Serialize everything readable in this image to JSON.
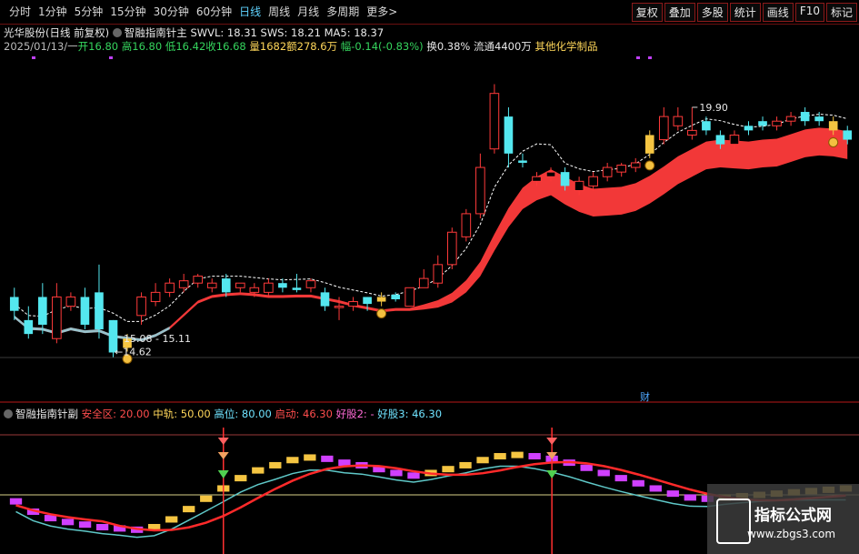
{
  "toolbar": {
    "periods": [
      "分时",
      "1分钟",
      "5分钟",
      "15分钟",
      "30分钟",
      "60分钟",
      "日线",
      "周线",
      "月线",
      "多周期",
      "更多>"
    ],
    "active_period": "日线",
    "right_buttons": [
      "复权",
      "叠加",
      "多股",
      "统计",
      "画线",
      "F10",
      "标记"
    ]
  },
  "header": {
    "stock": "光华股份(日线 前复权)",
    "indicator": "智融指南针主",
    "swvl": "SWVL: 18.31",
    "sws": "SWS: 18.21",
    "ma5": "MA5: 18.37",
    "date": "2025/01/13/一",
    "open": "开16.80",
    "high": "高16.80",
    "low": "低16.42",
    "close": "收16.68",
    "vol": "量1682",
    "amount": "额278.6万",
    "change": "幅-0.14(-0.83%)",
    "turnover": "换0.38%",
    "float": "流通4400万",
    "sector": "其他化学制品"
  },
  "annotations": {
    "high_label": "19.90",
    "low_label": "14.62",
    "range_label": "15.08 - 15.11",
    "cai_label": "财"
  },
  "lower_panel": {
    "title": "智融指南针副",
    "safe": "安全区: 20.00",
    "mid": "中轨: 50.00",
    "high": "高位: 80.00",
    "start": "启动: 46.30",
    "good2": "好股2: -",
    "good3": "好股3: 46.30"
  },
  "watermark": {
    "name": "指标公式网",
    "url": "www.zbgs3.com"
  },
  "colors": {
    "up": "#ff3a3a",
    "down": "#54e7ef",
    "band": "#ff3b3b",
    "gold": "#f5c542"
  },
  "chart_data": {
    "type": "candlestick",
    "note": "daily candles, price axis approx 14 - 21",
    "candles": [
      {
        "o": 15.8,
        "c": 15.5,
        "h": 16.0,
        "l": 15.3
      },
      {
        "o": 15.3,
        "c": 15.0,
        "h": 15.6,
        "l": 14.9
      },
      {
        "o": 15.8,
        "c": 15.2,
        "h": 16.1,
        "l": 15.0
      },
      {
        "o": 14.9,
        "c": 15.8,
        "h": 16.1,
        "l": 14.8
      },
      {
        "o": 15.6,
        "c": 15.8,
        "h": 15.9,
        "l": 15.5
      },
      {
        "o": 15.8,
        "c": 15.2,
        "h": 16.0,
        "l": 15.1
      },
      {
        "o": 15.9,
        "c": 15.1,
        "h": 16.5,
        "l": 14.9
      },
      {
        "o": 15.3,
        "c": 14.6,
        "h": 15.3,
        "l": 14.5
      },
      {
        "o": 14.7,
        "c": 14.9,
        "h": 15.0,
        "l": 14.62
      },
      {
        "o": 15.4,
        "c": 15.8,
        "h": 15.9,
        "l": 15.2
      },
      {
        "o": 15.7,
        "c": 15.9,
        "h": 16.1,
        "l": 15.6
      },
      {
        "o": 15.9,
        "c": 16.1,
        "h": 16.2,
        "l": 15.8
      },
      {
        "o": 16.0,
        "c": 16.15,
        "h": 16.3,
        "l": 15.9
      },
      {
        "o": 16.1,
        "c": 16.25,
        "h": 16.3,
        "l": 16.0
      },
      {
        "o": 16.0,
        "c": 16.1,
        "h": 16.2,
        "l": 15.9
      },
      {
        "o": 16.2,
        "c": 15.9,
        "h": 16.3,
        "l": 15.8
      },
      {
        "o": 16.0,
        "c": 16.1,
        "h": 16.1,
        "l": 15.9
      },
      {
        "o": 15.9,
        "c": 16.0,
        "h": 16.1,
        "l": 15.8
      },
      {
        "o": 15.9,
        "c": 16.1,
        "h": 16.2,
        "l": 15.8
      },
      {
        "o": 16.1,
        "c": 16.0,
        "h": 16.2,
        "l": 15.9
      },
      {
        "o": 16.0,
        "c": 15.95,
        "h": 16.3,
        "l": 15.9
      },
      {
        "o": 16.0,
        "c": 16.15,
        "h": 16.2,
        "l": 15.9
      },
      {
        "o": 15.9,
        "c": 15.6,
        "h": 16.0,
        "l": 15.5
      },
      {
        "o": 15.6,
        "c": 15.6,
        "h": 15.8,
        "l": 15.3
      },
      {
        "o": 15.6,
        "c": 15.7,
        "h": 15.8,
        "l": 15.5
      },
      {
        "o": 15.8,
        "c": 15.65,
        "h": 15.8,
        "l": 15.5
      },
      {
        "o": 15.7,
        "c": 15.8,
        "h": 15.9,
        "l": 15.6
      },
      {
        "o": 15.85,
        "c": 15.75,
        "h": 15.9,
        "l": 15.7
      },
      {
        "o": 15.6,
        "c": 16.0,
        "h": 16.0,
        "l": 15.6
      },
      {
        "o": 16.0,
        "c": 16.2,
        "h": 16.4,
        "l": 16.0
      },
      {
        "o": 16.1,
        "c": 16.5,
        "h": 16.7,
        "l": 16.0
      },
      {
        "o": 16.5,
        "c": 17.2,
        "h": 17.3,
        "l": 16.4
      },
      {
        "o": 17.1,
        "c": 17.6,
        "h": 17.7,
        "l": 17.0
      },
      {
        "o": 17.6,
        "c": 18.6,
        "h": 18.9,
        "l": 17.5
      },
      {
        "o": 19.0,
        "c": 20.2,
        "h": 20.4,
        "l": 18.9
      },
      {
        "o": 19.7,
        "c": 18.9,
        "h": 19.9,
        "l": 18.6
      },
      {
        "o": 18.75,
        "c": 18.7,
        "h": 18.9,
        "l": 18.6
      },
      {
        "o": 18.3,
        "c": 18.4,
        "h": 18.5,
        "l": 18.2
      },
      {
        "o": 18.4,
        "c": 18.5,
        "h": 18.6,
        "l": 18.3
      },
      {
        "o": 18.5,
        "c": 18.2,
        "h": 18.6,
        "l": 18.1
      },
      {
        "o": 18.1,
        "c": 18.3,
        "h": 18.4,
        "l": 18.0
      },
      {
        "o": 18.2,
        "c": 18.4,
        "h": 18.5,
        "l": 18.1
      },
      {
        "o": 18.4,
        "c": 18.6,
        "h": 18.7,
        "l": 18.3
      },
      {
        "o": 18.5,
        "c": 18.65,
        "h": 18.7,
        "l": 18.4
      },
      {
        "o": 18.6,
        "c": 18.7,
        "h": 18.8,
        "l": 18.5
      },
      {
        "o": 18.9,
        "c": 19.3,
        "h": 19.4,
        "l": 18.8
      },
      {
        "o": 19.2,
        "c": 19.7,
        "h": 19.9,
        "l": 19.1
      },
      {
        "o": 19.5,
        "c": 19.7,
        "h": 19.9,
        "l": 19.4
      },
      {
        "o": 19.3,
        "c": 19.4,
        "h": 19.9,
        "l": 19.2
      },
      {
        "o": 19.6,
        "c": 19.4,
        "h": 19.7,
        "l": 19.3
      },
      {
        "o": 19.3,
        "c": 19.1,
        "h": 19.4,
        "l": 19.0
      },
      {
        "o": 19.1,
        "c": 19.3,
        "h": 19.4,
        "l": 19.0
      },
      {
        "o": 19.5,
        "c": 19.4,
        "h": 19.6,
        "l": 19.3
      },
      {
        "o": 19.6,
        "c": 19.5,
        "h": 19.7,
        "l": 19.4
      },
      {
        "o": 19.5,
        "c": 19.6,
        "h": 19.7,
        "l": 19.4
      },
      {
        "o": 19.6,
        "c": 19.7,
        "h": 19.8,
        "l": 19.5
      },
      {
        "o": 19.8,
        "c": 19.6,
        "h": 19.9,
        "l": 19.5
      },
      {
        "o": 19.7,
        "c": 19.6,
        "h": 19.8,
        "l": 19.5
      },
      {
        "o": 19.6,
        "c": 19.4,
        "h": 19.7,
        "l": 19.3
      },
      {
        "o": 19.4,
        "c": 19.2,
        "h": 19.5,
        "l": 19.1
      }
    ],
    "gold_candles": [
      8,
      26,
      45,
      58
    ],
    "lower": {
      "levels": {
        "safe": 20.0,
        "mid": 50.0,
        "high": 80.0
      },
      "start": 46.3,
      "good3": 46.3,
      "signal_bars": [
        12,
        31
      ],
      "osc": [
        38,
        30,
        25,
        22,
        20,
        18,
        17,
        16,
        18,
        24,
        32,
        40,
        48,
        56,
        62,
        66,
        70,
        72,
        71,
        68,
        66,
        63,
        60,
        58,
        60,
        63,
        66,
        70,
        73,
        74,
        73,
        71,
        68,
        64,
        60,
        56,
        52,
        48,
        44,
        41,
        40,
        41,
        42,
        43,
        44,
        45,
        46,
        47,
        48
      ]
    }
  }
}
